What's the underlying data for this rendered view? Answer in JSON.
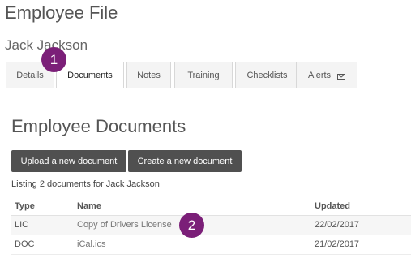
{
  "page": {
    "title": "Employee File",
    "employee_name": "Jack Jackson"
  },
  "tabs": [
    {
      "label": "Details"
    },
    {
      "label": "Documents"
    },
    {
      "label": "Notes"
    },
    {
      "label": "Training"
    },
    {
      "label": "Checklists"
    },
    {
      "label": "Alerts",
      "icon": "envelope-icon"
    }
  ],
  "active_tab": "Documents",
  "documents": {
    "title": "Employee Documents",
    "upload_label": "Upload a new document",
    "create_label": "Create a new document",
    "listing": "Listing 2 documents for Jack Jackson",
    "columns": {
      "type": "Type",
      "name": "Name",
      "updated": "Updated"
    },
    "rows": [
      {
        "type": "LIC",
        "name": "Copy of Drivers License",
        "updated": "22/02/2017"
      },
      {
        "type": "DOC",
        "name": "iCal.ics",
        "updated": "21/02/2017"
      }
    ]
  },
  "callouts": {
    "one": "1",
    "two": "2",
    "color": "#7b1f78"
  },
  "colors": {
    "button_bg": "#505050",
    "text": "#555555"
  }
}
